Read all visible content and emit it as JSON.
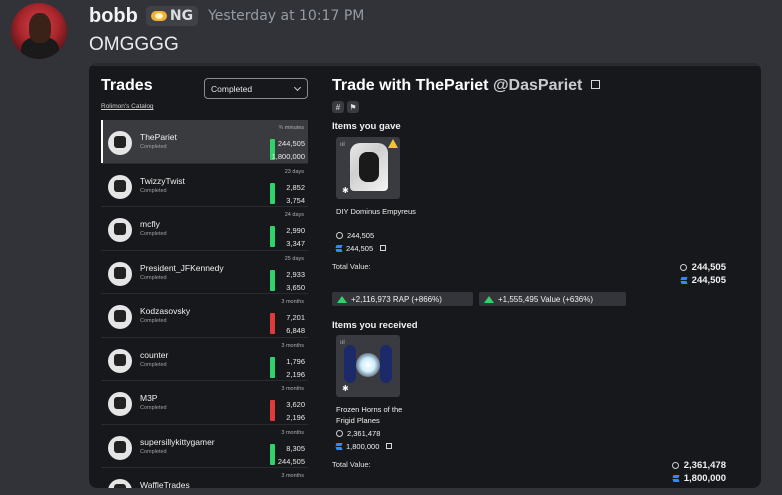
{
  "message": {
    "username": "bobb",
    "tag": "NG",
    "timestamp": "Yesterday at 10:17 PM",
    "text": "OMGGGG"
  },
  "left_panel": {
    "title": "Trades",
    "catalog_link": "Rolimon's Catalog",
    "filter": {
      "selected": "Completed"
    },
    "rows": [
      {
        "name": "ThePariet",
        "status": "Completed",
        "time": "¾ minutes",
        "give": "244,505",
        "get": "1,800,000",
        "bar": "green",
        "active": true
      },
      {
        "name": "TwizzyTwist",
        "status": "Completed",
        "time": "23 days",
        "give": "2,852",
        "get": "3,754",
        "bar": "green"
      },
      {
        "name": "mcfly",
        "status": "Completed",
        "time": "24 days",
        "give": "2,990",
        "get": "3,347",
        "bar": "green"
      },
      {
        "name": "President_JFKennedy",
        "status": "Completed",
        "time": "25 days",
        "give": "2,933",
        "get": "3,650",
        "bar": "green"
      },
      {
        "name": "Kodzasovsky",
        "status": "Completed",
        "time": "3 months",
        "give": "7,201",
        "get": "6,848",
        "bar": "red"
      },
      {
        "name": "counter",
        "status": "Completed",
        "time": "3 months",
        "give": "1,796",
        "get": "2,196",
        "bar": "green"
      },
      {
        "name": "M3P",
        "status": "Completed",
        "time": "3 months",
        "give": "3,620",
        "get": "2,196",
        "bar": "red"
      },
      {
        "name": "supersillykittygamer",
        "status": "Completed",
        "time": "3 months",
        "give": "8,305",
        "get": "244,505",
        "bar": "green"
      },
      {
        "name": "WaffleTrades",
        "status": "",
        "time": "3 months",
        "give": "",
        "get": "",
        "bar": "none"
      }
    ]
  },
  "right_panel": {
    "title": "Trade with ThePariet",
    "handle": "@DasPariet",
    "gave_heading": "Items you gave",
    "gave_item": {
      "name": "DIY Dominus Empyreus",
      "rap": "244,505",
      "value": "244,505"
    },
    "gave_total_label": "Total Value:",
    "gave_total_rap": "244,505",
    "gave_total_value": "244,505",
    "gain_rap": "+2,116,973 RAP (+866%)",
    "gain_value": "+1,555,495 Value (+636%)",
    "received_heading": "Items you received",
    "received_item": {
      "name": "Frozen Horns of the Frigid Planes",
      "rap": "2,361,478",
      "value": "1,800,000"
    },
    "received_total_label": "Total Value:",
    "received_total_rap": "2,361,478",
    "received_total_value": "1,800,000"
  },
  "colors": {
    "green": "#2fd36a",
    "red": "#e03b3b",
    "accent": "#2e8bff"
  }
}
